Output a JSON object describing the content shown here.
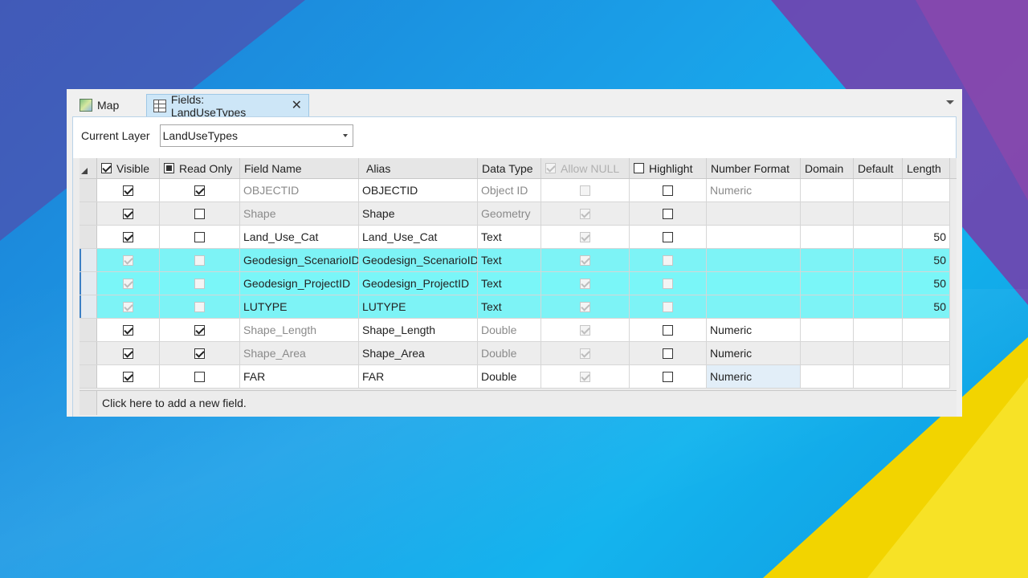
{
  "tabs": [
    {
      "label": "Map",
      "icon": "map-icon"
    },
    {
      "label": "Fields:  LandUseTypes",
      "icon": "table-icon",
      "close": "✕"
    }
  ],
  "layer": {
    "label": "Current Layer",
    "value": "LandUseTypes"
  },
  "columns": {
    "visible": "Visible",
    "read_only": "Read Only",
    "field_name": "Field Name",
    "alias": "Alias",
    "data_type": "Data Type",
    "allow_null": "Allow NULL",
    "highlight": "Highlight",
    "number_format": "Number Format",
    "domain": "Domain",
    "default": "Default",
    "length": "Length"
  },
  "rows": [
    {
      "field_name": "OBJECTID",
      "alias": "OBJECTID",
      "data_type": "Object ID",
      "number_format": "Numeric",
      "length": ""
    },
    {
      "field_name": "Shape",
      "alias": "Shape",
      "data_type": "Geometry",
      "number_format": "",
      "length": ""
    },
    {
      "field_name": "Land_Use_Cat",
      "alias": "Land_Use_Cat",
      "data_type": "Text",
      "number_format": "",
      "length": "50"
    },
    {
      "field_name": "Geodesign_ScenarioID",
      "alias": "Geodesign_ScenarioID",
      "data_type": "Text",
      "number_format": "",
      "length": "50"
    },
    {
      "field_name": "Geodesign_ProjectID",
      "alias": "Geodesign_ProjectID",
      "data_type": "Text",
      "number_format": "",
      "length": "50"
    },
    {
      "field_name": "LUTYPE",
      "alias": "LUTYPE",
      "data_type": "Text",
      "number_format": "",
      "length": "50"
    },
    {
      "field_name": "Shape_Length",
      "alias": "Shape_Length",
      "data_type": "Double",
      "number_format": "Numeric",
      "length": ""
    },
    {
      "field_name": "Shape_Area",
      "alias": "Shape_Area",
      "data_type": "Double",
      "number_format": "Numeric",
      "length": ""
    },
    {
      "field_name": "FAR",
      "alias": "FAR",
      "data_type": "Double",
      "number_format": "Numeric",
      "length": ""
    }
  ],
  "add_field": "Click here to add a new field."
}
